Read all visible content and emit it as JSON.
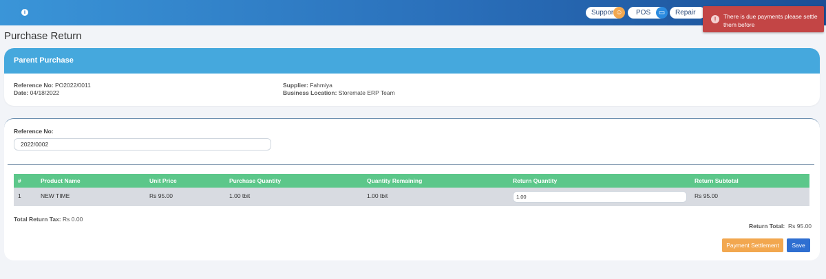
{
  "header": {
    "support_label": "Support",
    "pos_label": "POS",
    "repair_label": "Repair",
    "colors": {
      "bar": "#2a6fba",
      "support_icon": "#f2a74f",
      "pos_icon": "#2b8be0"
    }
  },
  "toast": {
    "message": "There is due payments please settle them before",
    "color": "#c34545"
  },
  "page": {
    "title": "Purchase Return"
  },
  "parent_purchase": {
    "title": "Parent Purchase",
    "reference_label": "Reference No:",
    "reference_value": "PO2022/0011",
    "date_label": "Date:",
    "date_value": "04/18/2022",
    "supplier_label": "Supplier:",
    "supplier_value": "Fahmiya",
    "location_label": "Business Location:",
    "location_value": "Storemate ERP Team"
  },
  "return_form": {
    "reference_label": "Reference No:",
    "reference_value": "2022/0002"
  },
  "table": {
    "columns": [
      "#",
      "Product Name",
      "Unit Price",
      "Purchase Quantity",
      "Quantity Remaining",
      "Return Quantity",
      "Return Subtotal"
    ],
    "rows": [
      {
        "index": "1",
        "product": "NEW TIME",
        "unit_price": "Rs 95.00",
        "purchase_qty": "1.00 tbit",
        "qty_remaining": "1.00 tbit",
        "return_qty": "1.00",
        "return_subtotal": "Rs 95.00"
      }
    ]
  },
  "totals": {
    "tax_label": "Total Return Tax:",
    "tax_value": "Rs 0.00",
    "return_total_label": "Return Total:",
    "return_total_value": "Rs 95.00"
  },
  "actions": {
    "payment_settlement_label": "Payment Settlement",
    "save_label": "Save"
  }
}
